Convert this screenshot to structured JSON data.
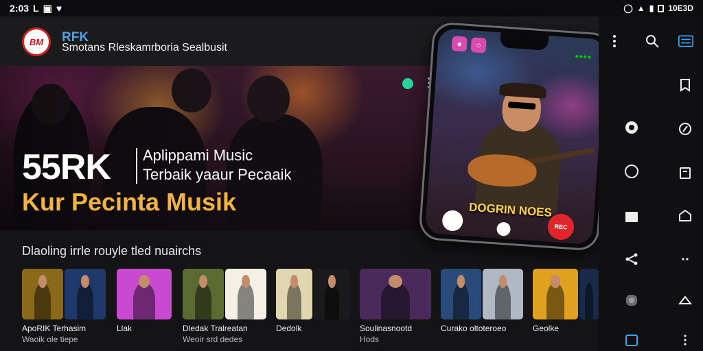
{
  "status_bar": {
    "time": "2:03",
    "right_text": "10E3D"
  },
  "header": {
    "logo_text": "BM",
    "brand": "RFK",
    "tagline": "Smotans Rleskamrboria Sealbusit"
  },
  "hero": {
    "stat": "55RK",
    "line1": "Aplippami Music",
    "line2": "Terbaik yaaur Pecaaik",
    "headline": "Kur Pecinta Musik",
    "accent_color": "#f2b340"
  },
  "phone": {
    "caption": "DOGRIN NOES",
    "record_label": "REC"
  },
  "section": {
    "title": "Dlaoling irrle rouyle tled nuairchs"
  },
  "cards": [
    {
      "title": "ApoRIK Terhasim",
      "subtitle": "Waoik ole tiepe",
      "colors": [
        "#8a6a1a",
        "#1f3a6a"
      ]
    },
    {
      "title": "Llak",
      "subtitle": "",
      "colors": [
        "#c84ad0",
        "#7a2aa8"
      ]
    },
    {
      "title": "Dledak Tralreatan",
      "subtitle": "Weoir srd dedes",
      "colors": [
        "#5a6a30",
        "#f4f0e6"
      ]
    },
    {
      "title": "Dedolk",
      "subtitle": "",
      "colors": [
        "#e0d6b0",
        "#1a1a1c"
      ]
    },
    {
      "title": "Soulinasnootd",
      "subtitle": "Hods",
      "colors": [
        "#4a2a5a",
        "#2a6a4a"
      ]
    },
    {
      "title": "Curako oltoteroeo",
      "subtitle": "",
      "colors": [
        "#2a4a7a",
        "#b0b8c4"
      ]
    },
    {
      "title": "Geolke",
      "subtitle": "",
      "colors": [
        "#e0a020",
        "#1a2a4a"
      ]
    }
  ],
  "side_nav": {
    "icons": [
      "more-icon",
      "search-icon",
      "menu-icon",
      "bookmark-icon",
      "chat-icon",
      "compass-icon",
      "circle-icon",
      "clipboard-icon",
      "folder-icon",
      "home-icon",
      "share-icon",
      "dots-icon",
      "settings-icon",
      "home-icon",
      "edit-icon",
      "more-icon"
    ]
  }
}
